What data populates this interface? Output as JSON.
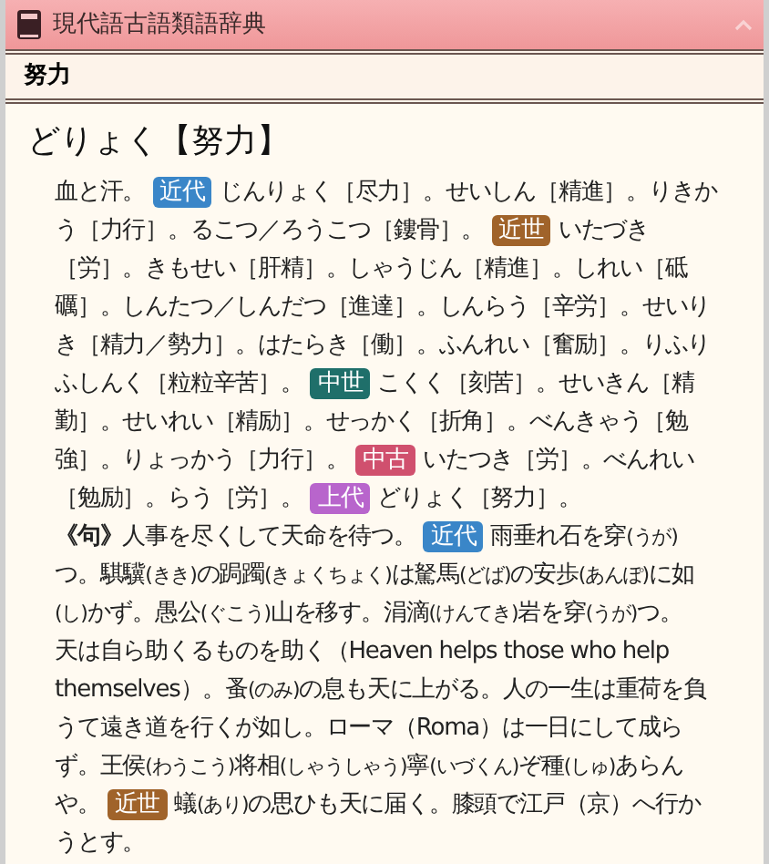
{
  "window": {
    "title": "現代語古語類語辞典"
  },
  "header": {
    "title": "努力"
  },
  "entry": {
    "headword": "どりょく【努力】",
    "paragraphs": [
      {
        "lines": [
          [
            {
              "kind": "text",
              "text": "血と汗。"
            },
            {
              "kind": "tag",
              "text": "近代",
              "color": "#3a86c8"
            },
            {
              "kind": "text",
              "text": "じんりょく［尽力］。せいしん［精進］。りきか"
            }
          ],
          [
            {
              "kind": "text",
              "text": "う［力行］。るこつ／ろうこつ［鏤骨］。"
            },
            {
              "kind": "tag",
              "text": "近世",
              "color": "#a0632a"
            },
            {
              "kind": "text",
              "text": "いたづき"
            }
          ],
          [
            {
              "kind": "text",
              "text": "［労］。きもせい［肝精］。しゃうじん［精進］。しれい［砥"
            }
          ],
          [
            {
              "kind": "text",
              "text": "礪］。しんたつ／しんだつ［進達］。しんらう［辛労］。せいり"
            }
          ],
          [
            {
              "kind": "text",
              "text": "き［精力／勢力］。はたらき［働］。ふんれい［奮励］。りふり"
            }
          ],
          [
            {
              "kind": "text",
              "text": "ふしんく［粒粒辛苦］。"
            },
            {
              "kind": "tag",
              "text": "中世",
              "color": "#1f6f6a"
            },
            {
              "kind": "text",
              "text": "こくく［刻苦］。せいきん［精"
            }
          ],
          [
            {
              "kind": "text",
              "text": "勤］。せいれい［精励］。せっかく［折角］。べんきゃう［勉"
            }
          ],
          [
            {
              "kind": "text",
              "text": "強］。りょっかう［力行］。"
            },
            {
              "kind": "tag",
              "text": "中古",
              "color": "#d0506e"
            },
            {
              "kind": "text",
              "text": "いたつき［労］。べんれい"
            }
          ],
          [
            {
              "kind": "text",
              "text": "［勉励］。らう［労］。"
            },
            {
              "kind": "tag",
              "text": "上代",
              "color": "#b865cc"
            },
            {
              "kind": "text",
              "text": "どりょく［努力］。"
            }
          ]
        ]
      },
      {
        "lines": [
          [
            {
              "kind": "label",
              "text": "《句》"
            },
            {
              "kind": "text",
              "text": "人事を尽くして天命を待つ。"
            },
            {
              "kind": "tag",
              "text": "近代",
              "color": "#3a86c8"
            },
            {
              "kind": "text",
              "text": "雨垂れ石を穿"
            },
            {
              "kind": "ruby",
              "text": "(うが)"
            }
          ],
          [
            {
              "kind": "text",
              "text": "つ。騏驥"
            },
            {
              "kind": "ruby",
              "text": "(きき)"
            },
            {
              "kind": "text",
              "text": "の跼躅"
            },
            {
              "kind": "ruby",
              "text": "(きょくちょく)"
            },
            {
              "kind": "text",
              "text": "は駑馬"
            },
            {
              "kind": "ruby",
              "text": "(どば)"
            },
            {
              "kind": "text",
              "text": "の安歩"
            },
            {
              "kind": "ruby",
              "text": "(あんぽ)"
            },
            {
              "kind": "text",
              "text": "に如"
            }
          ],
          [
            {
              "kind": "ruby",
              "text": "(し)"
            },
            {
              "kind": "text",
              "text": "かず。愚公"
            },
            {
              "kind": "ruby",
              "text": "(ぐこう)"
            },
            {
              "kind": "text",
              "text": "山を移す。涓滴"
            },
            {
              "kind": "ruby",
              "text": "(けんてき)"
            },
            {
              "kind": "text",
              "text": "岩を穿"
            },
            {
              "kind": "ruby",
              "text": "(うが)"
            },
            {
              "kind": "text",
              "text": "つ。"
            }
          ],
          [
            {
              "kind": "text",
              "text": "天は自ら助くるものを助く（Heaven helps those who help"
            }
          ],
          [
            {
              "kind": "text",
              "text": "themselves）。蚤"
            },
            {
              "kind": "ruby",
              "text": "(のみ)"
            },
            {
              "kind": "text",
              "text": "の息も天に上がる。人の一生は重荷を負"
            }
          ],
          [
            {
              "kind": "text",
              "text": "うて遠き道を行くが如し。ローマ（Roma）は一日にして成ら"
            }
          ],
          [
            {
              "kind": "text",
              "text": "ず。王侯"
            },
            {
              "kind": "ruby",
              "text": "(わうこう)"
            },
            {
              "kind": "text",
              "text": "将相"
            },
            {
              "kind": "ruby",
              "text": "(しゃうしゃう)"
            },
            {
              "kind": "text",
              "text": "寧"
            },
            {
              "kind": "ruby",
              "text": "(いづくん)"
            },
            {
              "kind": "text",
              "text": "ぞ種"
            },
            {
              "kind": "ruby",
              "text": "(しゅ)"
            },
            {
              "kind": "text",
              "text": "あらん"
            }
          ],
          [
            {
              "kind": "text",
              "text": "や。"
            },
            {
              "kind": "tag",
              "text": "近世",
              "color": "#a0632a"
            },
            {
              "kind": "text",
              "text": "蟻"
            },
            {
              "kind": "ruby",
              "text": "(あり)"
            },
            {
              "kind": "text",
              "text": "の思ひも天に届く。膝頭で江戸（京）へ行か"
            }
          ],
          [
            {
              "kind": "text",
              "text": "うとす。"
            }
          ]
        ]
      }
    ]
  }
}
